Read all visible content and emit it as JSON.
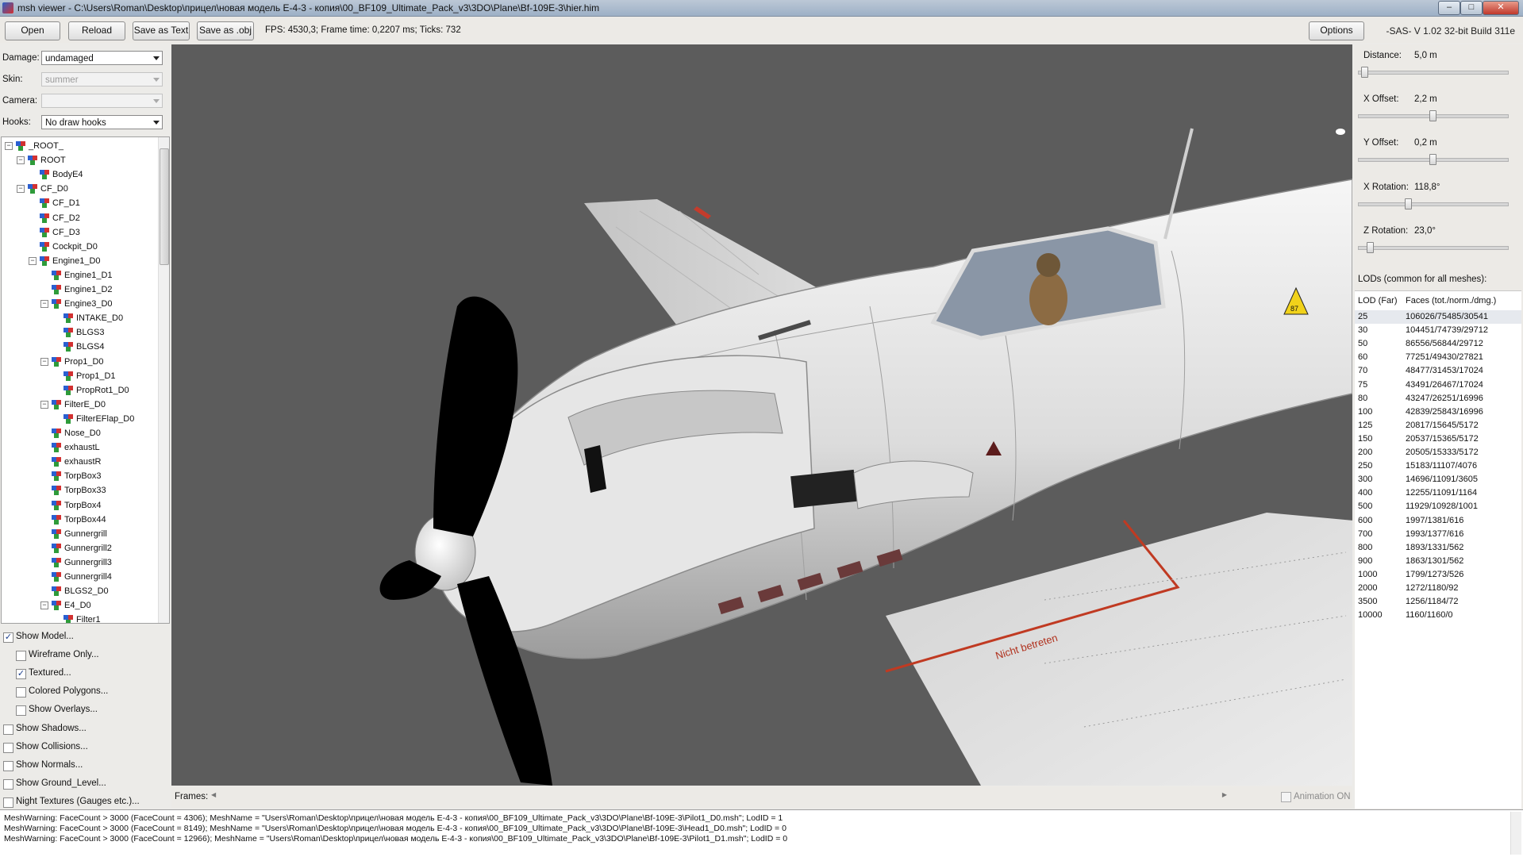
{
  "window": {
    "title": "msh viewer - C:\\Users\\Roman\\Desktop\\прицел\\новая модель E-4-3 - копия\\00_BF109_Ultimate_Pack_v3\\3DO\\Plane\\Bf-109E-3\\hier.him",
    "min_label": "–",
    "max_label": "□",
    "close_label": "✕"
  },
  "toolbar": {
    "open": "Open",
    "reload": "Reload",
    "save_text": "Save as Text",
    "save_obj": "Save as .obj",
    "fps": "FPS: 4530,3; Frame time: 0,2207 ms; Ticks: 732",
    "options": "Options",
    "version": "-SAS- V 1.02  32-bit  Build 311e"
  },
  "left": {
    "damage_label": "Damage:",
    "damage_value": "undamaged",
    "skin_label": "Skin:",
    "skin_value": "summer",
    "camera_label": "Camera:",
    "camera_value": "",
    "hooks_label": "Hooks:",
    "hooks_value": "No draw hooks",
    "tree": [
      {
        "label": "_ROOT_",
        "level": 0,
        "exp": "−"
      },
      {
        "label": "ROOT",
        "level": 1,
        "exp": "−"
      },
      {
        "label": "BodyE4",
        "level": 2,
        "exp": ""
      },
      {
        "label": "CF_D0",
        "level": 1,
        "exp": "−"
      },
      {
        "label": "CF_D1",
        "level": 2,
        "exp": ""
      },
      {
        "label": "CF_D2",
        "level": 2,
        "exp": ""
      },
      {
        "label": "CF_D3",
        "level": 2,
        "exp": ""
      },
      {
        "label": "Cockpit_D0",
        "level": 2,
        "exp": ""
      },
      {
        "label": "Engine1_D0",
        "level": 2,
        "exp": "−"
      },
      {
        "label": "Engine1_D1",
        "level": 3,
        "exp": ""
      },
      {
        "label": "Engine1_D2",
        "level": 3,
        "exp": ""
      },
      {
        "label": "Engine3_D0",
        "level": 3,
        "exp": "−"
      },
      {
        "label": "INTAKE_D0",
        "level": 4,
        "exp": ""
      },
      {
        "label": "BLGS3",
        "level": 4,
        "exp": ""
      },
      {
        "label": "BLGS4",
        "level": 4,
        "exp": ""
      },
      {
        "label": "Prop1_D0",
        "level": 3,
        "exp": "−"
      },
      {
        "label": "Prop1_D1",
        "level": 4,
        "exp": ""
      },
      {
        "label": "PropRot1_D0",
        "level": 4,
        "exp": ""
      },
      {
        "label": "FilterE_D0",
        "level": 3,
        "exp": "−"
      },
      {
        "label": "FilterEFlap_D0",
        "level": 4,
        "exp": ""
      },
      {
        "label": "Nose_D0",
        "level": 3,
        "exp": ""
      },
      {
        "label": "exhaustL",
        "level": 3,
        "exp": ""
      },
      {
        "label": "exhaustR",
        "level": 3,
        "exp": ""
      },
      {
        "label": "TorpBox3",
        "level": 3,
        "exp": ""
      },
      {
        "label": "TorpBox33",
        "level": 3,
        "exp": ""
      },
      {
        "label": "TorpBox4",
        "level": 3,
        "exp": ""
      },
      {
        "label": "TorpBox44",
        "level": 3,
        "exp": ""
      },
      {
        "label": "Gunnergrill",
        "level": 3,
        "exp": ""
      },
      {
        "label": "Gunnergrill2",
        "level": 3,
        "exp": ""
      },
      {
        "label": "Gunnergrill3",
        "level": 3,
        "exp": ""
      },
      {
        "label": "Gunnergrill4",
        "level": 3,
        "exp": ""
      },
      {
        "label": "BLGS2_D0",
        "level": 3,
        "exp": ""
      },
      {
        "label": "E4_D0",
        "level": 3,
        "exp": "−"
      },
      {
        "label": "Filter1",
        "level": 4,
        "exp": ""
      }
    ],
    "checks": [
      {
        "label": "Show Model...",
        "checked": true,
        "indent": false
      },
      {
        "label": "Wireframe Only...",
        "checked": false,
        "indent": true
      },
      {
        "label": "Textured...",
        "checked": true,
        "indent": true
      },
      {
        "label": "Colored Polygons...",
        "checked": false,
        "indent": true
      },
      {
        "label": "Show Overlays...",
        "checked": false,
        "indent": true
      },
      {
        "label": "Show Shadows...",
        "checked": false,
        "indent": false
      },
      {
        "label": "Show Collisions...",
        "checked": false,
        "indent": false
      },
      {
        "label": "Show Normals...",
        "checked": false,
        "indent": false
      },
      {
        "label": "Show Ground_Level...",
        "checked": false,
        "indent": false
      },
      {
        "label": "Night Textures (Gauges etc.)...",
        "checked": false,
        "indent": false
      }
    ]
  },
  "viewport": {
    "decal_number": "87",
    "flap_text": "Nicht betreten",
    "check_mark": "✓"
  },
  "frames": {
    "label": "Frames:",
    "animation": "Animation ON",
    "left_arrow": "◀",
    "right_arrow": "▶"
  },
  "right": {
    "sliders": [
      {
        "label": "Distance:",
        "value": "5,0 m",
        "level": 0.02
      },
      {
        "label": "X Offset:",
        "value": "2,2 m",
        "level": 0.5
      },
      {
        "label": "Y Offset:",
        "value": "0,2 m",
        "level": 0.5
      },
      {
        "label": "X Rotation:",
        "value": "118,8°",
        "level": 0.33
      },
      {
        "label": "Z Rotation:",
        "value": "23,0°",
        "level": 0.06
      }
    ],
    "lods_title": "LODs (common for all meshes):",
    "lods_header": {
      "a": "LOD (Far)",
      "b": "Faces (tot./norm./dmg.)"
    },
    "lods": [
      {
        "lod": "25",
        "faces": "106026/75485/30541"
      },
      {
        "lod": "30",
        "faces": "104451/74739/29712"
      },
      {
        "lod": "50",
        "faces": "86556/56844/29712"
      },
      {
        "lod": "60",
        "faces": "77251/49430/27821"
      },
      {
        "lod": "70",
        "faces": "48477/31453/17024"
      },
      {
        "lod": "75",
        "faces": "43491/26467/17024"
      },
      {
        "lod": "80",
        "faces": "43247/26251/16996"
      },
      {
        "lod": "100",
        "faces": "42839/25843/16996"
      },
      {
        "lod": "125",
        "faces": "20817/15645/5172"
      },
      {
        "lod": "150",
        "faces": "20537/15365/5172"
      },
      {
        "lod": "200",
        "faces": "20505/15333/5172"
      },
      {
        "lod": "250",
        "faces": "15183/11107/4076"
      },
      {
        "lod": "300",
        "faces": "14696/11091/3605"
      },
      {
        "lod": "400",
        "faces": "12255/11091/1164"
      },
      {
        "lod": "500",
        "faces": "11929/10928/1001"
      },
      {
        "lod": "600",
        "faces": "1997/1381/616"
      },
      {
        "lod": "700",
        "faces": "1993/1377/616"
      },
      {
        "lod": "800",
        "faces": "1893/1331/562"
      },
      {
        "lod": "900",
        "faces": "1863/1301/562"
      },
      {
        "lod": "1000",
        "faces": "1799/1273/526"
      },
      {
        "lod": "2000",
        "faces": "1272/1180/92"
      },
      {
        "lod": "3500",
        "faces": "1256/1184/72"
      },
      {
        "lod": "10000",
        "faces": "1160/1160/0"
      }
    ]
  },
  "log": [
    "MeshWarning: FaceCount > 3000 (FaceCount = 4306); MeshName = \"Users\\Roman\\Desktop\\прицел\\новая модель E-4-3 - копия\\00_BF109_Ultimate_Pack_v3\\3DO\\Plane\\Bf-109E-3\\Pilot1_D0.msh\"; LodID = 1",
    "MeshWarning: FaceCount > 3000 (FaceCount = 8149); MeshName = \"Users\\Roman\\Desktop\\прицел\\новая модель E-4-3 - копия\\00_BF109_Ultimate_Pack_v3\\3DO\\Plane\\Bf-109E-3\\Head1_D0.msh\"; LodID = 0",
    "MeshWarning: FaceCount > 3000 (FaceCount = 12966); MeshName = \"Users\\Roman\\Desktop\\прицел\\новая модель E-4-3 - копия\\00_BF109_Ultimate_Pack_v3\\3DO\\Plane\\Bf-109E-3\\Pilot1_D1.msh\"; LodID = 0"
  ]
}
